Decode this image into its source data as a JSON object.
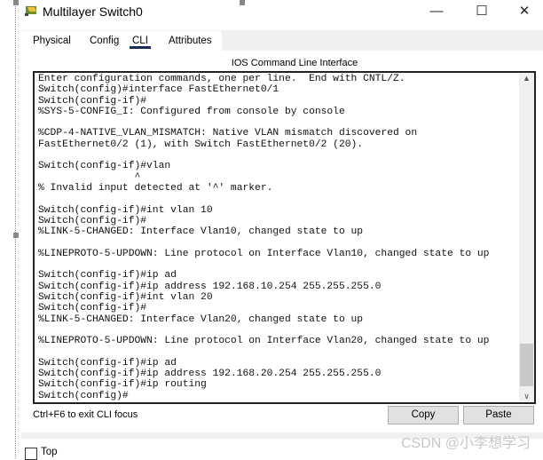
{
  "window": {
    "title": "Multilayer Switch0",
    "minimize": "—",
    "maximize": "☐",
    "close": "✕"
  },
  "tabs": [
    {
      "label": "Physical"
    },
    {
      "label": "Config"
    },
    {
      "label": "CLI",
      "active": true
    },
    {
      "label": "Attributes"
    }
  ],
  "cli": {
    "title": "IOS Command Line Interface",
    "lines": [
      "Enter configuration commands, one per line.  End with CNTL/Z.",
      "Switch(config)#interface FastEthernet0/1",
      "Switch(config-if)#",
      "%SYS-5-CONFIG_I: Configured from console by console",
      "",
      "%CDP-4-NATIVE_VLAN_MISMATCH: Native VLAN mismatch discovered on",
      "FastEthernet0/2 (1), with Switch FastEthernet0/2 (20).",
      "",
      "Switch(config-if)#vlan",
      "                ^",
      "% Invalid input detected at '^' marker.",
      "",
      "Switch(config-if)#int vlan 10",
      "Switch(config-if)#",
      "%LINK-5-CHANGED: Interface Vlan10, changed state to up",
      "",
      "%LINEPROTO-5-UPDOWN: Line protocol on Interface Vlan10, changed state to up",
      "",
      "Switch(config-if)#ip ad",
      "Switch(config-if)#ip address 192.168.10.254 255.255.255.0",
      "Switch(config-if)#int vlan 20",
      "Switch(config-if)#",
      "%LINK-5-CHANGED: Interface Vlan20, changed state to up",
      "",
      "%LINEPROTO-5-UPDOWN: Line protocol on Interface Vlan20, changed state to up",
      "",
      "Switch(config-if)#ip ad",
      "Switch(config-if)#ip address 192.168.20.254 255.255.255.0",
      "Switch(config-if)#ip routing",
      "Switch(config)#"
    ],
    "hint": "Ctrl+F6 to exit CLI focus",
    "copy": "Copy",
    "paste": "Paste"
  },
  "footer": {
    "top_label": "Top",
    "top_checked": false
  },
  "watermark": "CSDN @小李想学习"
}
